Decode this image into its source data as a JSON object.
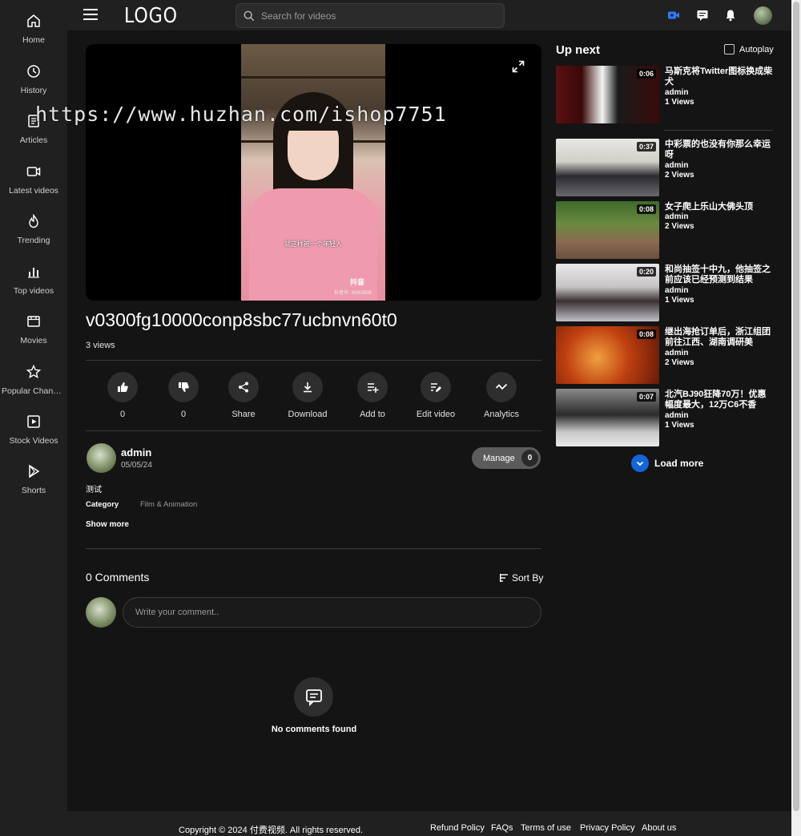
{
  "brand": {
    "logo": "LOGO"
  },
  "search": {
    "placeholder": "Search for videos"
  },
  "sidebar": {
    "items": [
      {
        "label": "Home",
        "icon": "home-icon"
      },
      {
        "label": "History",
        "icon": "history-icon"
      },
      {
        "label": "Articles",
        "icon": "articles-icon"
      },
      {
        "label": "Latest videos",
        "icon": "video-camera-icon"
      },
      {
        "label": "Trending",
        "icon": "fire-icon"
      },
      {
        "label": "Top videos",
        "icon": "bar-chart-icon"
      },
      {
        "label": "Movies",
        "icon": "film-icon"
      },
      {
        "label": "Popular Channels",
        "icon": "star-icon"
      },
      {
        "label": "Stock Videos",
        "icon": "play-square-icon"
      },
      {
        "label": "Shorts",
        "icon": "shorts-icon"
      }
    ]
  },
  "colors": {
    "accent": "#1565d8",
    "upload_icon": "#2b7bff",
    "background": "#141414",
    "panel": "#202020"
  },
  "watermark": "https://www.huzhan.com/ishop7751",
  "player": {
    "subtitle": "就这样被一个年轻人",
    "platform": "抖音",
    "platform_id": "抖音号: XKK0808"
  },
  "video": {
    "title": "v0300fg10000conp8sbc77ucbnvn60t0",
    "views": "3 views",
    "description": "测试",
    "category_label": "Category",
    "category": "Film & Animation",
    "show_more": "Show more"
  },
  "actions": [
    {
      "label": "0",
      "icon": "thumbs-up-icon"
    },
    {
      "label": "0",
      "icon": "thumbs-down-icon"
    },
    {
      "label": "Share",
      "icon": "share-icon"
    },
    {
      "label": "Download",
      "icon": "download-icon"
    },
    {
      "label": "Add to",
      "icon": "playlist-add-icon"
    },
    {
      "label": "Edit video",
      "icon": "edit-icon"
    },
    {
      "label": "Analytics",
      "icon": "analytics-icon"
    }
  ],
  "channel": {
    "name": "admin",
    "date": "05/05/24",
    "manage_label": "Manage",
    "manage_count": "0"
  },
  "comments": {
    "heading": "0 Comments",
    "sort_label": "Sort By",
    "placeholder": "Write your comment..",
    "empty_text": "No comments found"
  },
  "up_next": {
    "heading": "Up next",
    "autoplay_label": "Autoplay",
    "load_more": "Load more",
    "items": [
      {
        "duration": "0:06",
        "title": "马斯克将Twitter图标换成柴犬",
        "author": "admin",
        "views": "1 Views"
      },
      {
        "duration": "0:37",
        "title": "中彩票的也没有你那么幸运呀",
        "author": "admin",
        "views": "2 Views"
      },
      {
        "duration": "0:08",
        "title": "女子爬上乐山大佛头顶",
        "author": "admin",
        "views": "2 Views"
      },
      {
        "duration": "0:20",
        "title": "和尚抽签十中九，他抽签之前应该已经预测到结果",
        "author": "admin",
        "views": "1 Views"
      },
      {
        "duration": "0:08",
        "title": "继出海抢订单后，浙江组团前往江西、湖南调研美",
        "author": "admin",
        "views": "2 Views"
      },
      {
        "duration": "0:07",
        "title": "北汽BJ90狂降70万！优惠幅度最大，12万C6不香",
        "author": "admin",
        "views": "1 Views"
      }
    ]
  },
  "footer": {
    "copyright": "Copyright © 2024 付费视频. All rights reserved.",
    "links": [
      "Refund Policy",
      "FAQs",
      "Terms of use",
      "Privacy Policy",
      "About us"
    ]
  }
}
